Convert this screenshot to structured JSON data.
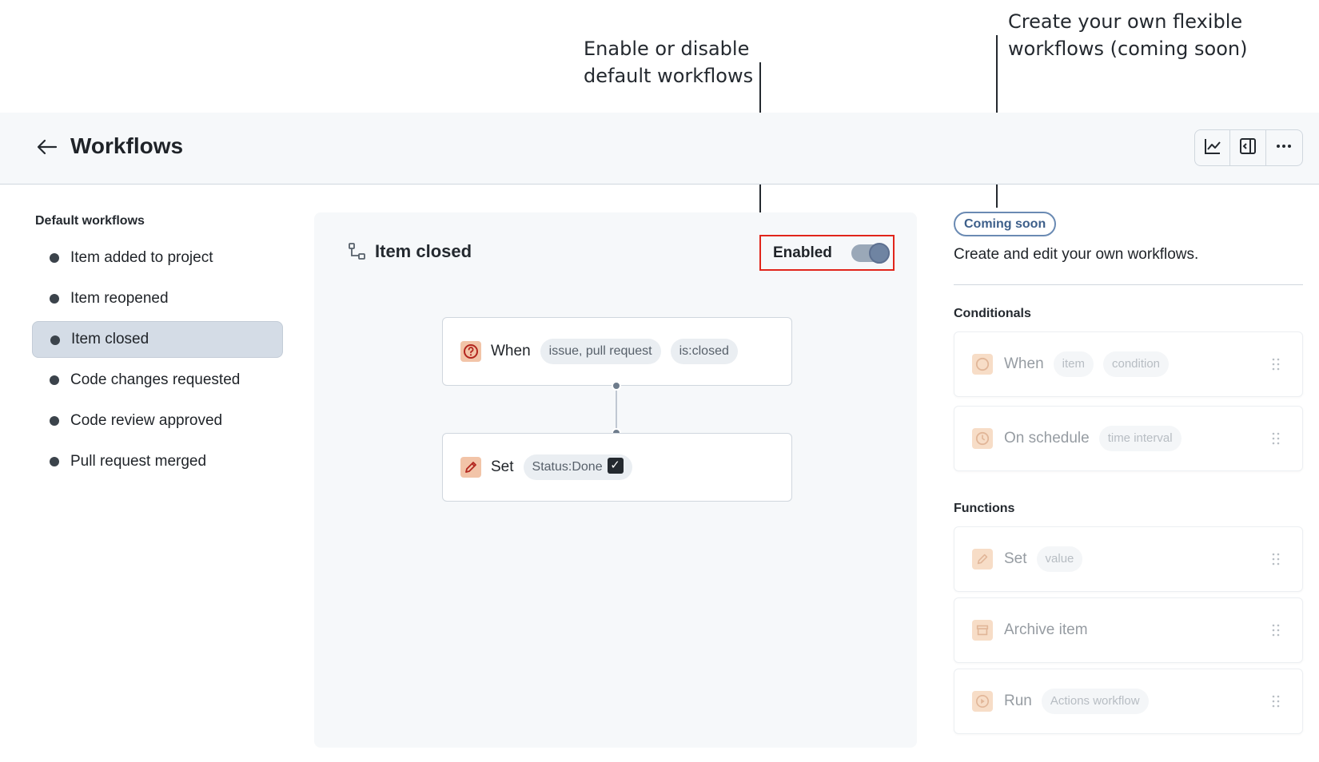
{
  "callouts": {
    "enable_disable": "Enable or disable default workflows",
    "create_own": "Create your own flexible workflows (coming soon)"
  },
  "header": {
    "title": "Workflows",
    "icons": [
      "back-arrow-icon",
      "graph-icon",
      "sidebar-panel-icon",
      "kebab-menu-icon"
    ]
  },
  "sidebar": {
    "heading": "Default workflows",
    "items": [
      {
        "label": "Item added to project",
        "selected": false
      },
      {
        "label": "Item reopened",
        "selected": false
      },
      {
        "label": "Item closed",
        "selected": true
      },
      {
        "label": "Code changes requested",
        "selected": false
      },
      {
        "label": "Code review approved",
        "selected": false
      },
      {
        "label": "Pull request merged",
        "selected": false
      }
    ]
  },
  "workflow": {
    "title": "Item closed",
    "enabled_label": "Enabled",
    "enabled": true,
    "when": {
      "keyword": "When",
      "chips": [
        "issue, pull request",
        "is:closed"
      ]
    },
    "set": {
      "keyword": "Set",
      "chip": "Status:Done"
    }
  },
  "right_panel": {
    "badge": "Coming soon",
    "description": "Create and edit your own workflows.",
    "conditionals_heading": "Conditionals",
    "conditionals": [
      {
        "keyword": "When",
        "chips": [
          "item",
          "condition"
        ]
      },
      {
        "keyword": "On schedule",
        "chips": [
          "time interval"
        ]
      }
    ],
    "functions_heading": "Functions",
    "functions": [
      {
        "keyword": "Set",
        "chips": [
          "value"
        ]
      },
      {
        "keyword": "Archive item",
        "chips": []
      },
      {
        "keyword": "Run",
        "chips": [
          "Actions workflow"
        ]
      }
    ]
  },
  "colors": {
    "highlight_box": "#e1251b",
    "selected_item_bg": "#d4dce6",
    "panel_bg": "#f6f8fa",
    "badge_border": "#6a8ab3"
  }
}
